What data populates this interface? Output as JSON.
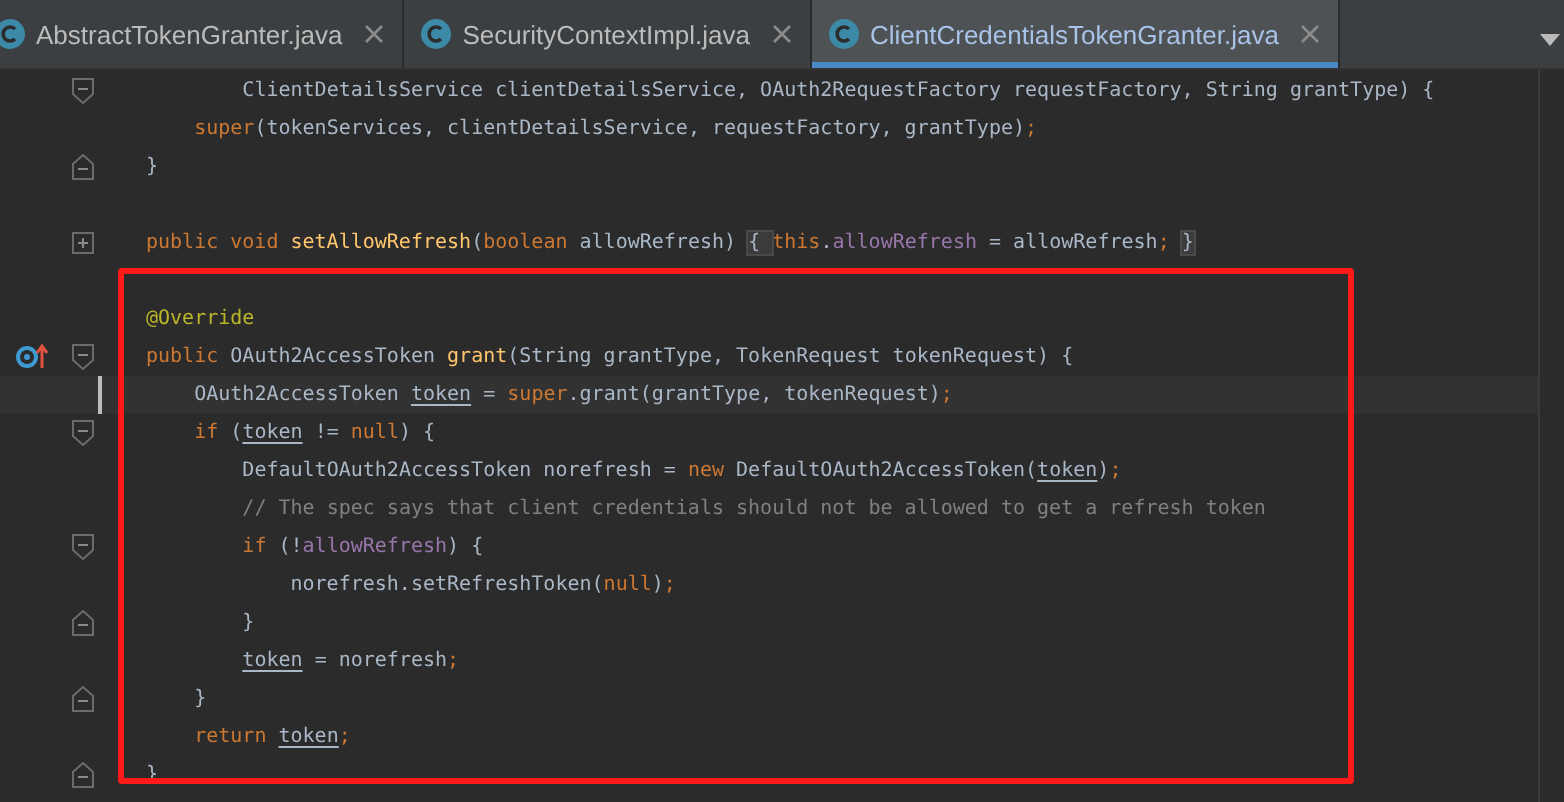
{
  "tabs": [
    {
      "label": "AbstractTokenGranter.java",
      "selected": false
    },
    {
      "label": "SecurityContextImpl.java",
      "selected": false
    },
    {
      "label": "ClientCredentialsTokenGranter.java",
      "selected": true
    }
  ],
  "code_lines": [
    {
      "fold_open": true,
      "fold_close": false,
      "collapsed": false,
      "overrides": false,
      "current": false,
      "tokens": [
        {
          "kind": "plain",
          "text": "        ClientDetailsService clientDetailsService, OAuth2RequestFactory requestFactory, String grantType) {"
        }
      ]
    },
    {
      "fold_open": false,
      "fold_close": false,
      "collapsed": false,
      "overrides": false,
      "current": false,
      "tokens": [
        {
          "kind": "keyword",
          "text": "    super"
        },
        {
          "kind": "plain",
          "text": "(tokenServices, clientDetailsService, requestFactory, grantType)"
        },
        {
          "kind": "keyword",
          "text": ";"
        }
      ]
    },
    {
      "fold_open": false,
      "fold_close": true,
      "collapsed": false,
      "overrides": false,
      "current": false,
      "tokens": [
        {
          "kind": "plain",
          "text": "}"
        }
      ]
    },
    {
      "fold_open": false,
      "fold_close": false,
      "collapsed": false,
      "overrides": false,
      "current": false
    },
    {
      "fold_open": false,
      "fold_close": false,
      "collapsed": true,
      "overrides": false,
      "current": false,
      "tokens": [
        {
          "kind": "keyword",
          "text": "public void "
        },
        {
          "kind": "method",
          "text": "setAllowRefresh"
        },
        {
          "kind": "plain",
          "text": "("
        },
        {
          "kind": "keyword",
          "text": "boolean "
        },
        {
          "kind": "plain",
          "text": "allowRefresh) "
        },
        {
          "kind": "folded",
          "text": "{ "
        },
        {
          "kind": "keyword",
          "text": "this"
        },
        {
          "kind": "plain",
          "text": "."
        },
        {
          "kind": "field",
          "text": "allowRefresh"
        },
        {
          "kind": "plain",
          "text": " = allowRefresh"
        },
        {
          "kind": "keyword",
          "text": "; "
        },
        {
          "kind": "folded",
          "text": "}"
        }
      ]
    },
    {
      "fold_open": false,
      "fold_close": false,
      "collapsed": false,
      "overrides": false,
      "current": false
    },
    {
      "fold_open": false,
      "fold_close": false,
      "collapsed": false,
      "overrides": false,
      "current": false,
      "tokens": [
        {
          "kind": "annotation",
          "text": "@Override"
        }
      ]
    },
    {
      "fold_open": true,
      "fold_close": false,
      "collapsed": false,
      "overrides": true,
      "current": false,
      "tokens": [
        {
          "kind": "keyword",
          "text": "public "
        },
        {
          "kind": "plain",
          "text": "OAuth2AccessToken "
        },
        {
          "kind": "method",
          "text": "grant"
        },
        {
          "kind": "plain",
          "text": "(String grantType, TokenRequest tokenRequest) {"
        }
      ]
    },
    {
      "fold_open": false,
      "fold_close": false,
      "collapsed": false,
      "overrides": false,
      "current": true,
      "tokens": [
        {
          "kind": "plain",
          "text": "    OAuth2AccessToken "
        },
        {
          "kind": "underlined",
          "text": "token"
        },
        {
          "kind": "plain",
          "text": " = "
        },
        {
          "kind": "keyword",
          "text": "super"
        },
        {
          "kind": "plain",
          "text": ".grant(grantType, tokenRequest)"
        },
        {
          "kind": "keyword",
          "text": ";"
        }
      ]
    },
    {
      "fold_open": true,
      "fold_close": false,
      "collapsed": false,
      "overrides": false,
      "current": false,
      "tokens": [
        {
          "kind": "keyword",
          "text": "    if "
        },
        {
          "kind": "plain",
          "text": "("
        },
        {
          "kind": "underlined",
          "text": "token"
        },
        {
          "kind": "plain",
          "text": " != "
        },
        {
          "kind": "keyword",
          "text": "null"
        },
        {
          "kind": "plain",
          "text": ") {"
        }
      ]
    },
    {
      "fold_open": false,
      "fold_close": false,
      "collapsed": false,
      "overrides": false,
      "current": false,
      "tokens": [
        {
          "kind": "plain",
          "text": "        DefaultOAuth2AccessToken norefresh = "
        },
        {
          "kind": "keyword",
          "text": "new "
        },
        {
          "kind": "plain",
          "text": "DefaultOAuth2AccessToken("
        },
        {
          "kind": "underlined",
          "text": "token"
        },
        {
          "kind": "plain",
          "text": ")"
        },
        {
          "kind": "keyword",
          "text": ";"
        }
      ]
    },
    {
      "fold_open": false,
      "fold_close": false,
      "collapsed": false,
      "overrides": false,
      "current": false,
      "tokens": [
        {
          "kind": "comment",
          "text": "        // The spec says that client credentials should not be allowed to get a refresh token"
        }
      ]
    },
    {
      "fold_open": true,
      "fold_close": false,
      "collapsed": false,
      "overrides": false,
      "current": false,
      "tokens": [
        {
          "kind": "keyword",
          "text": "        if "
        },
        {
          "kind": "plain",
          "text": "(!"
        },
        {
          "kind": "field",
          "text": "allowRefresh"
        },
        {
          "kind": "plain",
          "text": ") {"
        }
      ]
    },
    {
      "fold_open": false,
      "fold_close": false,
      "collapsed": false,
      "overrides": false,
      "current": false,
      "tokens": [
        {
          "kind": "plain",
          "text": "            norefresh.setRefreshToken("
        },
        {
          "kind": "keyword",
          "text": "null"
        },
        {
          "kind": "plain",
          "text": ")"
        },
        {
          "kind": "keyword",
          "text": ";"
        }
      ]
    },
    {
      "fold_open": false,
      "fold_close": true,
      "collapsed": false,
      "overrides": false,
      "current": false,
      "tokens": [
        {
          "kind": "plain",
          "text": "        }"
        }
      ]
    },
    {
      "fold_open": false,
      "fold_close": false,
      "collapsed": false,
      "overrides": false,
      "current": false,
      "tokens": [
        {
          "kind": "underlined",
          "text": "        token"
        },
        {
          "kind": "plain",
          "text": " = norefresh"
        },
        {
          "kind": "keyword",
          "text": ";"
        }
      ]
    },
    {
      "fold_open": false,
      "fold_close": true,
      "collapsed": false,
      "overrides": false,
      "current": false,
      "tokens": [
        {
          "kind": "plain",
          "text": "    }"
        }
      ]
    },
    {
      "fold_open": false,
      "fold_close": false,
      "collapsed": false,
      "overrides": false,
      "current": false,
      "tokens": [
        {
          "kind": "keyword",
          "text": "    return "
        },
        {
          "kind": "underlined",
          "text": "token"
        },
        {
          "kind": "keyword",
          "text": ";"
        }
      ]
    },
    {
      "fold_open": false,
      "fold_close": true,
      "collapsed": false,
      "overrides": false,
      "current": false,
      "tokens": [
        {
          "kind": "plain",
          "text": "}"
        }
      ]
    }
  ]
}
